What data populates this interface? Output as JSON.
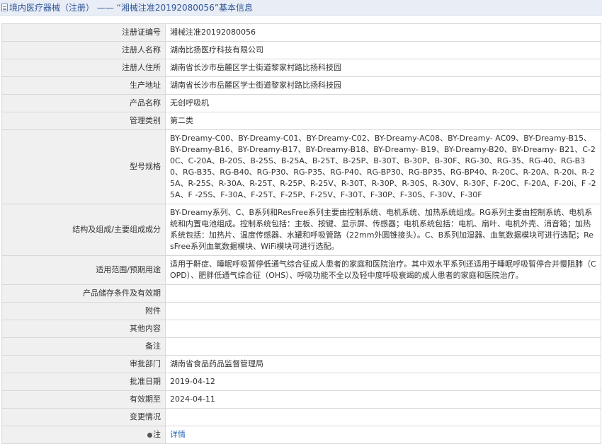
{
  "header": {
    "title": "境内医疗器械（注册） —— “湘械注准20192080056”基本信息"
  },
  "rows": [
    {
      "label": "注册证编号",
      "value": "湘械注准20192080056"
    },
    {
      "label": "注册人名称",
      "value": "湖南比扬医疗科技有限公司"
    },
    {
      "label": "注册人住所",
      "value": "湖南省长沙市岳麓区学士街道黎家村路比扬科技园"
    },
    {
      "label": "生产地址",
      "value": "湖南省长沙市岳麓区学士街道黎家村路比扬科技园"
    },
    {
      "label": "产品名称",
      "value": "无创呼吸机"
    },
    {
      "label": "管理类别",
      "value": "第二类"
    },
    {
      "label": "型号规格",
      "value": "BY-Dreamy-C00、BY-Dreamy-C01、BY-Dreamy-C02、BY-Dreamy-AC08、BY-Dreamy- AC09、BY-Dreamy-B15、BY-Dreamy-B16、BY-Dreamy-B17、BY-Dreamy-B18、BY-Dreamy- B19、BY-Dreamy-B20、BY-Dreamy- B21、C-20C、C-20A、B-20S、B-25S、B-25A、B-25T、B-25P、B-30T、B-30P、B-30F、RG-30、RG-35、RG-40、RG-B30、RG-B35、RG-B40、RG-P30、RG-P35、RG-P40、RG-BP30、RG-BP35、RG-BP40、R-20C、R-20A、R-20i、R-25A、R-25S、R-30A、R-25T、R-25P、R-25V、R-30T、R-30P、R-30S、R-30V、R-30F、F-20C、F-20A、F-20i、F -25A、F -25S、F-30A、F-25T、F-25P、F-25V、F-30T、F-30P、F-30S、F-30V、F-30F"
    },
    {
      "label": "结构及组成/主要组成成分",
      "value": "BY-Dreamy系列、C、B系列和ResFree系列主要由控制系统、电机系统、加热系统组成。RG系列主要由控制系统、电机系统和内置电池组成。控制系统包括：主板、按键、显示屏、传感器；电机系统包括：电机、扇叶、电机外壳、消音箱；加热系统包括：加热片、温度传感器、水罐和呼吸管路（22mm外圆锥接头）。C、B系列加湿器、血氧数据模块可进行选配；ResFree系列血氧数据模块、WiFi模块可进行选配。"
    },
    {
      "label": "适用范围/预期用途",
      "value": "适用于鼾症、睡眠呼吸暂停低通气综合征成人患者的家庭和医院治疗。其中双水平系列还适用于睡眠呼吸暂停合并慢阻肺（COPD）、肥胖低通气综合征（OHS）、呼吸功能不全以及轻中度呼吸衰竭的成人患者的家庭和医院治疗。"
    },
    {
      "label": "产品储存条件及有效期",
      "value": ""
    },
    {
      "label": "附件",
      "value": ""
    },
    {
      "label": "其他内容",
      "value": ""
    },
    {
      "label": "备注",
      "value": ""
    },
    {
      "label": "审批部门",
      "value": "湖南省食品药品监督管理局"
    },
    {
      "label": "批准日期",
      "value": "2019-04-12"
    },
    {
      "label": "有效期至",
      "value": "2024-04-11"
    },
    {
      "label": "变更情况",
      "value": ""
    },
    {
      "label": "注",
      "value": "详情"
    }
  ]
}
